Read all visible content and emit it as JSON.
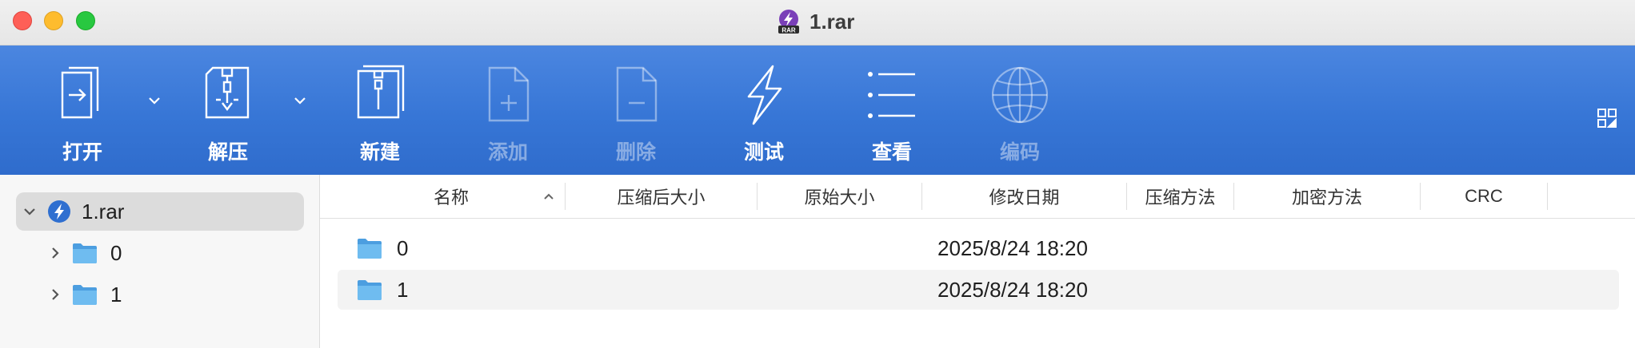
{
  "window": {
    "title": "1.rar",
    "badge": "RAR",
    "controls": [
      "close",
      "minimize",
      "zoom"
    ]
  },
  "toolbar": {
    "buttons": [
      {
        "id": "open",
        "label": "打开",
        "icon": "open-file-icon",
        "enabled": true,
        "has_menu": true
      },
      {
        "id": "extract",
        "label": "解压",
        "icon": "extract-archive-icon",
        "enabled": true,
        "has_menu": true
      },
      {
        "id": "new",
        "label": "新建",
        "icon": "new-archive-icon",
        "enabled": true,
        "has_menu": false
      },
      {
        "id": "add",
        "label": "添加",
        "icon": "add-file-icon",
        "enabled": false,
        "has_menu": false
      },
      {
        "id": "delete",
        "label": "删除",
        "icon": "delete-file-icon",
        "enabled": false,
        "has_menu": false
      },
      {
        "id": "test",
        "label": "测试",
        "icon": "lightning-icon",
        "enabled": true,
        "has_menu": false
      },
      {
        "id": "view",
        "label": "查看",
        "icon": "list-view-icon",
        "enabled": true,
        "has_menu": false
      },
      {
        "id": "encoding",
        "label": "编码",
        "icon": "globe-icon",
        "enabled": false,
        "has_menu": false
      }
    ]
  },
  "sidebar": {
    "root": {
      "label": "1.rar",
      "expanded": true
    },
    "children": [
      {
        "label": "0",
        "expanded": false
      },
      {
        "label": "1",
        "expanded": false
      }
    ]
  },
  "table": {
    "columns": [
      "名称",
      "压缩后大小",
      "原始大小",
      "修改日期",
      "压缩方法",
      "加密方法",
      "CRC"
    ],
    "sort_column": "名称",
    "sort_direction": "ascending",
    "rows": [
      {
        "name": "0",
        "packed": "",
        "size": "",
        "modified": "2025/8/24 18:20",
        "method": "",
        "encryption": "",
        "crc": ""
      },
      {
        "name": "1",
        "packed": "",
        "size": "",
        "modified": "2025/8/24 18:20",
        "method": "",
        "encryption": "",
        "crc": ""
      }
    ]
  },
  "colors": {
    "toolbar_top": "#4b86e0",
    "toolbar_bottom": "#2f6ccc",
    "folder": "#5aaee8",
    "selection": "#dcdcdc"
  }
}
